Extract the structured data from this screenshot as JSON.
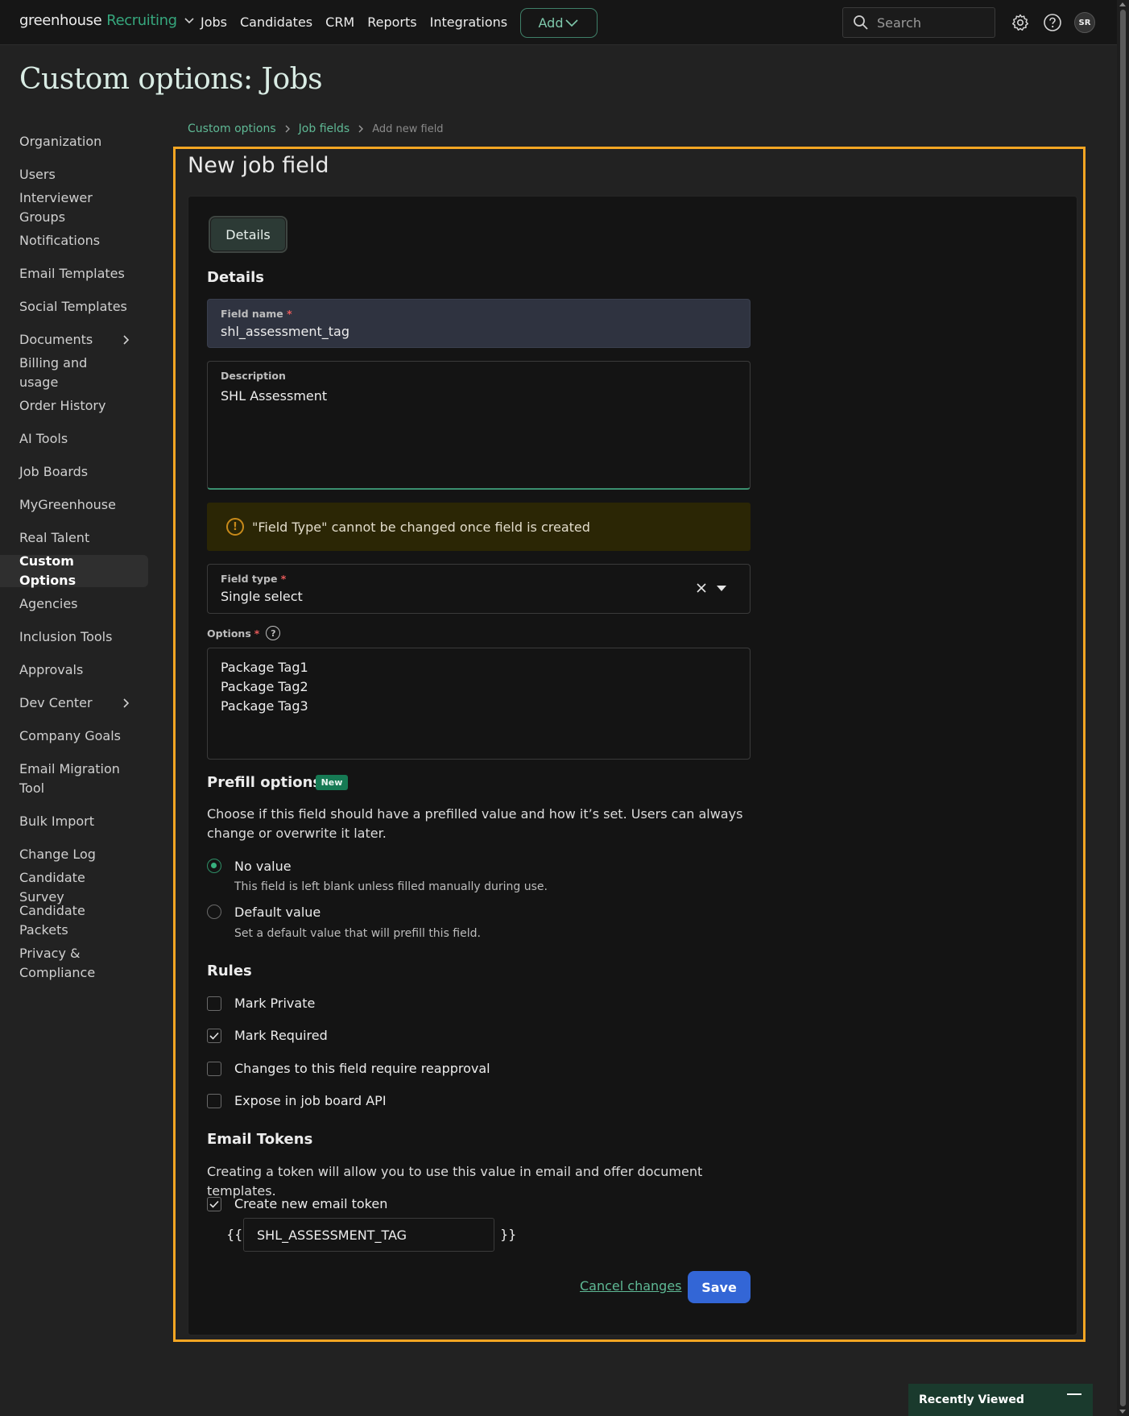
{
  "topbar": {
    "logo_word": "greenhouse",
    "logo_product": "Recruiting",
    "nav": [
      "Jobs",
      "Candidates",
      "CRM",
      "Reports",
      "Integrations"
    ],
    "add_label": "Add",
    "search_placeholder": "Search",
    "avatar_initials": "SR"
  },
  "page": {
    "title": "Custom options: Jobs"
  },
  "sidebar": {
    "items": [
      {
        "label": "Organization"
      },
      {
        "label": "Users"
      },
      {
        "label": "Interviewer Groups"
      },
      {
        "label": "Notifications"
      },
      {
        "label": "Email Templates"
      },
      {
        "label": "Social Templates"
      },
      {
        "label": "Documents",
        "expandable": true
      },
      {
        "label": "Billing and usage"
      },
      {
        "label": "Order History"
      },
      {
        "label": "AI Tools"
      },
      {
        "label": "Job Boards"
      },
      {
        "label": "MyGreenhouse"
      },
      {
        "label": "Real Talent"
      },
      {
        "label": "Custom Options",
        "active": true
      },
      {
        "label": "Agencies"
      },
      {
        "label": "Inclusion Tools"
      },
      {
        "label": "Approvals"
      },
      {
        "label": "Dev Center",
        "expandable": true
      },
      {
        "label": "Company Goals"
      },
      {
        "label": "Email Migration Tool"
      },
      {
        "label": "Bulk Import"
      },
      {
        "label": "Change Log"
      },
      {
        "label": "Candidate Survey"
      },
      {
        "label": "Candidate Packets"
      },
      {
        "label": "Privacy & Compliance"
      }
    ]
  },
  "breadcrumb": [
    "Custom options",
    "Job fields",
    "Add new field"
  ],
  "form": {
    "title": "New job field",
    "tab": "Details",
    "details_heading": "Details",
    "field_name": {
      "label": "Field name",
      "value": "shl_assessment_tag"
    },
    "description": {
      "label": "Description",
      "value": "SHL Assessment"
    },
    "warning": "\"Field Type\" cannot be changed once field is created",
    "field_type": {
      "label": "Field type",
      "value": "Single select"
    },
    "options": {
      "label": "Options",
      "values": [
        "Package Tag1",
        "Package Tag2",
        "Package Tag3"
      ]
    },
    "prefill": {
      "heading": "Prefill options",
      "badge": "New",
      "description": "Choose if this field should have a prefilled value and how it’s set. Users can always change or overwrite it later.",
      "choices": [
        {
          "label": "No value",
          "sub": "This field is left blank unless filled manually during use.",
          "selected": true
        },
        {
          "label": "Default value",
          "sub": "Set a default value that will prefill this field.",
          "selected": false
        }
      ]
    },
    "rules": {
      "heading": "Rules",
      "items": [
        {
          "label": "Mark Private",
          "checked": false
        },
        {
          "label": "Mark Required",
          "checked": true
        },
        {
          "label": "Changes to this field require reapproval",
          "checked": false
        },
        {
          "label": "Expose in job board API",
          "checked": false
        }
      ]
    },
    "email_tokens": {
      "heading": "Email Tokens",
      "description": "Creating a token will allow you to use this value in email and offer document templates.",
      "create_label": "Create new email token",
      "create_checked": true,
      "open_brace": "{{",
      "close_brace": "}}",
      "token_value": "SHL_ASSESSMENT_TAG"
    },
    "cancel_label": "Cancel changes",
    "save_label": "Save"
  },
  "recently_viewed": "Recently Viewed",
  "colors": {
    "accent_green": "#36a77d",
    "highlight": "#f5a623",
    "save_blue": "#3366d6"
  }
}
